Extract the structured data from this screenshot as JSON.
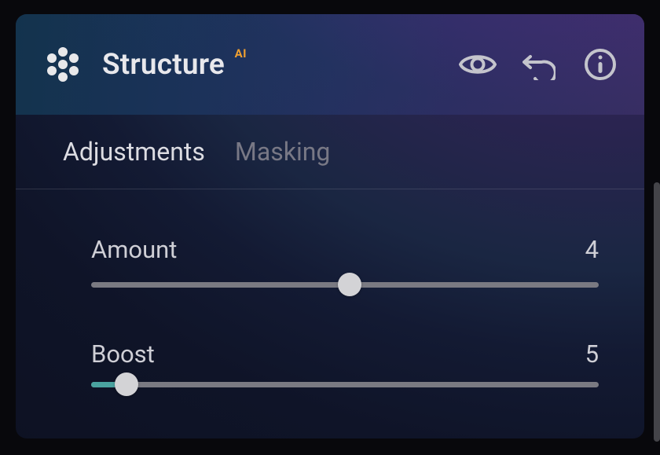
{
  "header": {
    "title": "Structure",
    "ai_badge": "AI"
  },
  "tabs": [
    {
      "label": "Adjustments",
      "active": true
    },
    {
      "label": "Masking",
      "active": false
    }
  ],
  "sliders": {
    "amount": {
      "label": "Amount",
      "value": 4,
      "min": -100,
      "max": 100,
      "thumb_pct": 51,
      "fill_from_pct": 50,
      "fill_to_pct": 51
    },
    "boost": {
      "label": "Boost",
      "value": 5,
      "min": 0,
      "max": 100,
      "thumb_pct": 7,
      "fill_from_pct": 0,
      "fill_to_pct": 5
    }
  },
  "colors": {
    "accent_teal": "#4aa3a0",
    "ai_badge": "#f0a030"
  }
}
